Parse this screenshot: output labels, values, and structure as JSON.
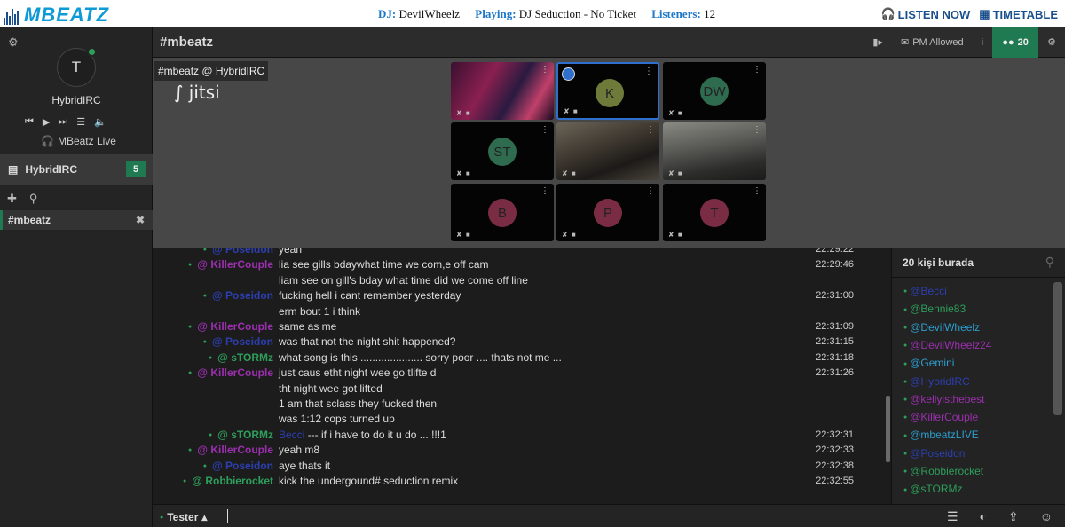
{
  "logo": "MBEATZ",
  "nowplaying": {
    "dj_label": "DJ:",
    "dj_value": "DevilWheelz",
    "playing_label": "Playing:",
    "playing_value": "DJ Seduction - No Ticket",
    "listeners_label": "Listeners:",
    "listeners_value": "12"
  },
  "topnav": {
    "listen": "LISTEN NOW",
    "timetable": "TIMETABLE"
  },
  "sidebar": {
    "avatar_initial": "T",
    "username": "HybridIRC",
    "radio_label": "MBeatz Live",
    "network": {
      "name": "HybridIRC",
      "count": "5"
    },
    "channel": "#mbeatz"
  },
  "header": {
    "channel": "#mbeatz",
    "pm_allowed": "PM Allowed",
    "user_count": "20"
  },
  "video": {
    "label": "#mbeatz @ HybridIRC",
    "brand": "jitsi",
    "tiles": [
      {
        "initials": "",
        "color": "",
        "kind": "camera-stage"
      },
      {
        "initials": "K",
        "color": "#6e7a3a",
        "kind": "avatar",
        "active": true
      },
      {
        "initials": "DW",
        "color": "#2f6b4f",
        "kind": "avatar"
      },
      {
        "initials": "ST",
        "color": "#2f6b4f",
        "kind": "avatar"
      },
      {
        "initials": "",
        "color": "",
        "kind": "camera-room"
      },
      {
        "initials": "",
        "color": "",
        "kind": "camera-couch"
      },
      {
        "initials": "B",
        "color": "#7a2c44",
        "kind": "avatar"
      },
      {
        "initials": "P",
        "color": "#7a2c44",
        "kind": "avatar"
      },
      {
        "initials": "T",
        "color": "#7a2c44",
        "kind": "avatar"
      }
    ]
  },
  "chat": {
    "messages": [
      {
        "nick": "@ Poseidon",
        "nickColor": "#2d3fb0",
        "text": "yeah",
        "time": "22:29:22",
        "indent": 1
      },
      {
        "nick": "@ KillerCouple",
        "nickColor": "#9b2fae",
        "text": "lia see gills bdaywhat time we com,e off cam",
        "time": "22:29:46",
        "indent": 0
      },
      {
        "nick": "",
        "nickColor": "",
        "text": "liam see on gill's bday what time did we come off line",
        "time": "",
        "indent": 0
      },
      {
        "nick": "@ Poseidon",
        "nickColor": "#2d3fb0",
        "text": "fucking hell i cant remember yesterday",
        "time": "22:31:00",
        "indent": 1
      },
      {
        "nick": "",
        "nickColor": "",
        "text": "erm bout 1 i think",
        "time": "",
        "indent": 0
      },
      {
        "nick": "@ KillerCouple",
        "nickColor": "#9b2fae",
        "text": "same as me",
        "time": "22:31:09",
        "indent": 0
      },
      {
        "nick": "@ Poseidon",
        "nickColor": "#2d3fb0",
        "text": "was that not the night shit happened?",
        "time": "22:31:15",
        "indent": 1
      },
      {
        "nick": "@ sTORMz",
        "nickColor": "#2e9e5b",
        "text": "what song is this ..................... sorry poor .... thats not me ...",
        "time": "22:31:18",
        "indent": 2
      },
      {
        "nick": "@ KillerCouple",
        "nickColor": "#9b2fae",
        "text": "just caus etht night wee go tlifte d",
        "time": "22:31:26",
        "indent": 0
      },
      {
        "nick": "",
        "nickColor": "",
        "text": "tht night wee got lifted",
        "time": "",
        "indent": 0
      },
      {
        "nick": "",
        "nickColor": "",
        "text": "1 am that sclass they fucked then",
        "time": "",
        "indent": 0
      },
      {
        "nick": "",
        "nickColor": "",
        "text": "was 1:12 cops turned up",
        "time": "",
        "indent": 0
      },
      {
        "nick": "@ sTORMz",
        "nickColor": "#2e9e5b",
        "text": "--- if i have to do it u do ... !!!1",
        "mention": "Becci",
        "time": "22:32:31",
        "indent": 2
      },
      {
        "nick": "@ KillerCouple",
        "nickColor": "#9b2fae",
        "text": "yeah m8",
        "time": "22:32:33",
        "indent": 0
      },
      {
        "nick": "@ Poseidon",
        "nickColor": "#2d3fb0",
        "text": "aye thats it",
        "time": "22:32:38",
        "indent": 1
      },
      {
        "nick": "@ Robbierocket",
        "nickColor": "#2e9e5b",
        "text": "kick the undergound# seduction remix",
        "time": "22:32:55",
        "indent": -1
      }
    ]
  },
  "userlist": {
    "heading": "20 kişi burada",
    "users": [
      {
        "name": "@Becci",
        "color": "#2d3fb0"
      },
      {
        "name": "@Bennie83",
        "color": "#2e9e5b"
      },
      {
        "name": "@DevilWheelz",
        "color": "#2d9ecf"
      },
      {
        "name": "@DevilWheelz24",
        "color": "#9b2fae"
      },
      {
        "name": "@Gemini",
        "color": "#2d9ecf"
      },
      {
        "name": "@HybridIRC",
        "color": "#2d3fb0"
      },
      {
        "name": "@kellyisthebest",
        "color": "#9b2fae"
      },
      {
        "name": "@KillerCouple",
        "color": "#9b2fae"
      },
      {
        "name": "@mbeatzLIVE",
        "color": "#2d9ecf"
      },
      {
        "name": "@Poseidon",
        "color": "#2d3fb0"
      },
      {
        "name": "@Robbierocket",
        "color": "#2e9e5b"
      },
      {
        "name": "@sTORMz",
        "color": "#2e9e5b"
      }
    ]
  },
  "input": {
    "nick": "Tester"
  }
}
